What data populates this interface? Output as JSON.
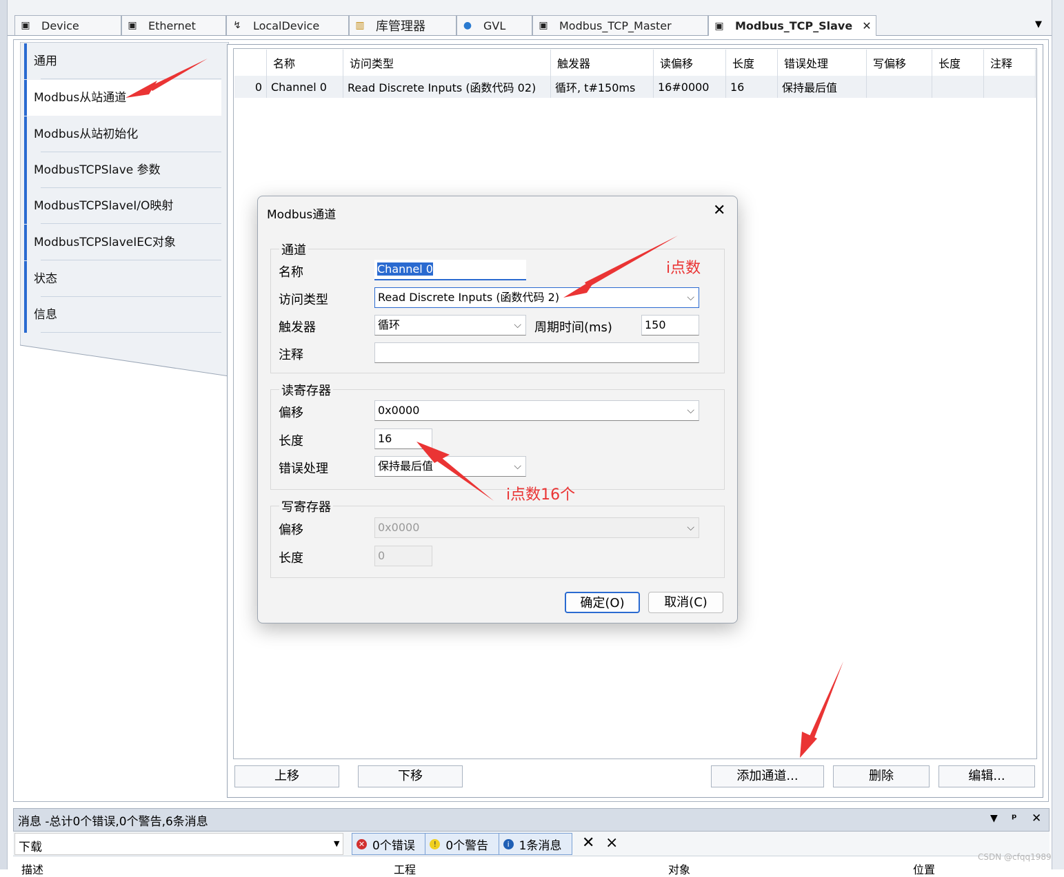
{
  "tabs": [
    {
      "label": "Device",
      "icon": "device-icon"
    },
    {
      "label": "Ethernet",
      "icon": "device-icon"
    },
    {
      "label": "LocalDevice",
      "icon": "local-device-icon"
    },
    {
      "label": "库管理器",
      "icon": "library-icon"
    },
    {
      "label": "GVL",
      "icon": "globe-icon"
    },
    {
      "label": "Modbus_TCP_Master",
      "icon": "device-icon"
    },
    {
      "label": "Modbus_TCP_Slave",
      "icon": "device-icon",
      "active": true
    }
  ],
  "tab_close": "✕",
  "nav": {
    "items": [
      {
        "label": "通用"
      },
      {
        "label": "Modbus从站通道",
        "selected": true
      },
      {
        "label": "Modbus从站初始化"
      },
      {
        "label": "ModbusTCPSlave 参数"
      },
      {
        "label": "ModbusTCPSlaveI/O映射"
      },
      {
        "label": "ModbusTCPSlaveIEC对象"
      },
      {
        "label": "状态"
      },
      {
        "label": "信息"
      }
    ]
  },
  "table": {
    "headers": [
      "",
      "名称",
      "访问类型",
      "触发器",
      "读偏移",
      "长度",
      "错误处理",
      "写偏移",
      "长度",
      "注释"
    ],
    "rows": [
      [
        "0",
        "Channel 0",
        "Read Discrete Inputs (函数代码 02)",
        "循环, t#150ms",
        "16#0000",
        "16",
        "保持最后值",
        "",
        "",
        ""
      ]
    ]
  },
  "buttons": {
    "move_up": "上移",
    "move_down": "下移",
    "add_channel": "添加通道...",
    "delete": "删除",
    "edit": "编辑..."
  },
  "dialog": {
    "title": "Modbus通道",
    "group_channel": "通道",
    "name_label": "名称",
    "name_value": "Channel 0",
    "access_label": "访问类型",
    "access_value": "Read Discrete Inputs (函数代码 2)",
    "trigger_label": "触发器",
    "trigger_value": "循环",
    "cycle_label": "周期时间(ms)",
    "cycle_value": "150",
    "comment_label": "注释",
    "comment_value": "",
    "group_read": "读寄存器",
    "read_offset_label": "偏移",
    "read_offset_value": "0x0000",
    "read_length_label": "长度",
    "read_length_value": "16",
    "error_label": "错误处理",
    "error_value": "保持最后值",
    "group_write": "写寄存器",
    "write_offset_label": "偏移",
    "write_offset_value": "0x0000",
    "write_length_label": "长度",
    "write_length_value": "0",
    "ok": "确定(O)",
    "cancel": "取消(C)"
  },
  "annotations": {
    "a1": "i点数",
    "a2": "i点数16个",
    "arrow_color": "#ea3434"
  },
  "messages": {
    "title": "消息 -总计0个错误,0个警告,6条消息",
    "source": "下载",
    "errors": "0个错误",
    "warnings": "0个警告",
    "infos": "1条消息",
    "columns": [
      "描述",
      "工程",
      "对象",
      "位置"
    ]
  },
  "watermark": "CSDN @cfqq1989"
}
